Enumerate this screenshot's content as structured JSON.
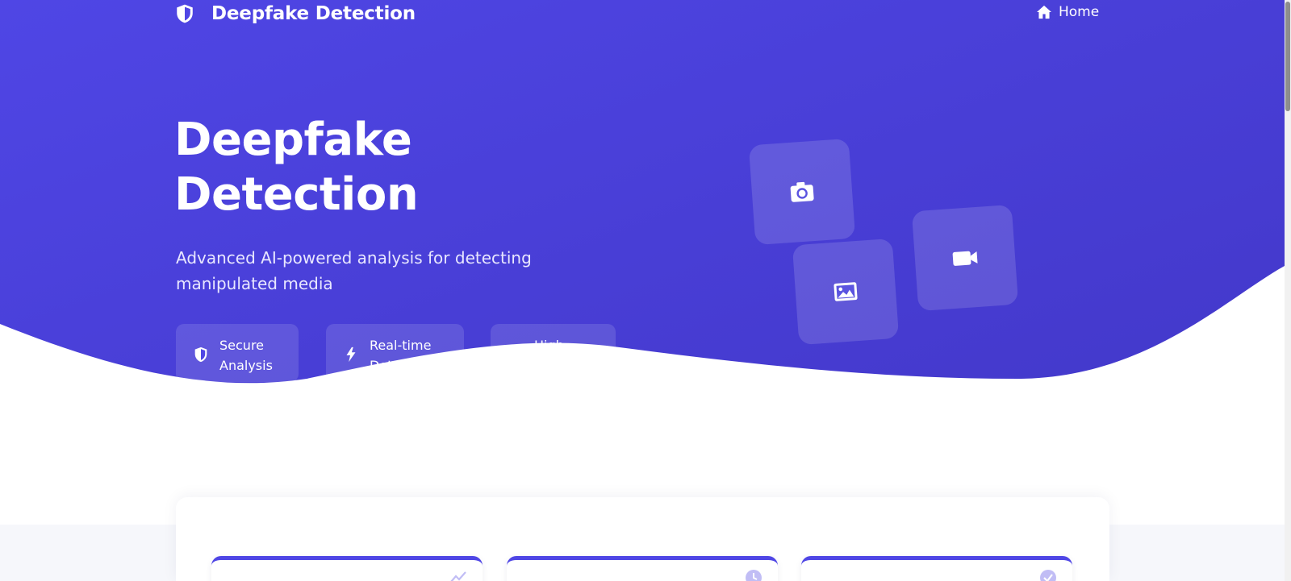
{
  "navbar": {
    "brand_icon": "shield-icon",
    "brand": "Deepfake Detection",
    "home_icon": "home-icon",
    "home_label": "Home"
  },
  "hero": {
    "title_line1": "Deepfake",
    "title_line2": "Detection",
    "subtitle": "Advanced AI-powered analysis for detecting manipulated media",
    "features": [
      {
        "icon": "shield-icon",
        "label": "Secure Analysis"
      },
      {
        "icon": "lightning-bolt-icon",
        "label": "Real-time Detection"
      },
      {
        "icon": "chart-icon",
        "label": "High Accuracy"
      }
    ],
    "media_tiles": [
      "camera-icon",
      "image-icon",
      "video-camera-icon"
    ]
  },
  "cards": [
    {
      "icon": "trend-chart-icon"
    },
    {
      "icon": "clock-icon"
    },
    {
      "icon": "check-circle-icon"
    }
  ],
  "colors": {
    "primary": "#4f46e5",
    "primary_dark": "#4338ca",
    "white": "#ffffff",
    "section_bg": "#f6f7fb"
  }
}
